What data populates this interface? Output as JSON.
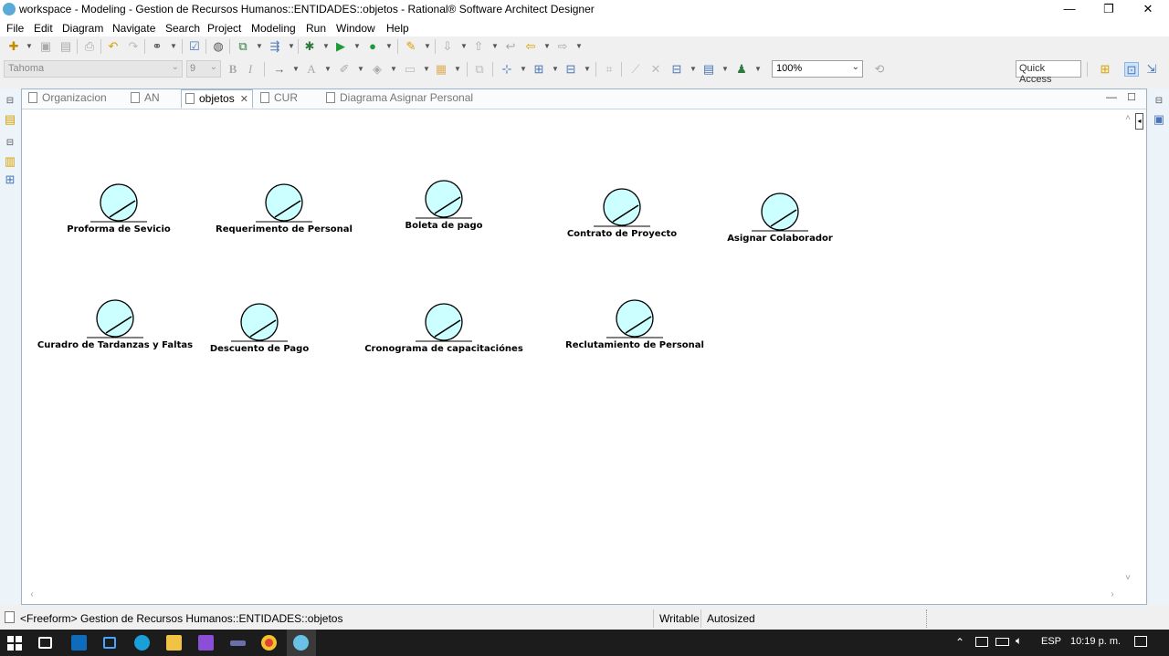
{
  "window": {
    "title": "workspace - Modeling - Gestion de Recursos Humanos::ENTIDADES::objetos - Rational® Software Architect Designer",
    "controls": {
      "minimize": "—",
      "restore": "❐",
      "close": "✕"
    }
  },
  "menu": [
    "File",
    "Edit",
    "Diagram",
    "Navigate",
    "Search",
    "Project",
    "Modeling",
    "Run",
    "Window",
    "Help"
  ],
  "toolbar2": {
    "font": "Tahoma",
    "font_size": "9",
    "bold": "B",
    "italic": "I",
    "zoom": "100%",
    "quick_access": "Quick Access"
  },
  "tabs": [
    {
      "label": "Organizacion",
      "active": false
    },
    {
      "label": "AN",
      "active": false
    },
    {
      "label": "objetos",
      "active": true,
      "close": "✕"
    },
    {
      "label": "CUR",
      "active": false
    },
    {
      "label": "Diagrama Asignar Personal",
      "active": false
    }
  ],
  "entities": [
    {
      "name": "Proforma de Sevicio"
    },
    {
      "name": "Requerimento de Personal"
    },
    {
      "name": "Boleta de pago"
    },
    {
      "name": "Contrato de Proyecto"
    },
    {
      "name": "Asignar Colaborador"
    },
    {
      "name": "Curadro de Tardanzas y Faltas"
    },
    {
      "name": "Descuento de Pago"
    },
    {
      "name": "Cronograma de capacitaciónes"
    },
    {
      "name": "Reclutamiento de Personal"
    }
  ],
  "entity_color": "#ccffff",
  "status": {
    "path": "<Freeform> Gestion de Recursos Humanos::ENTIDADES::objetos",
    "writable": "Writable",
    "autosized": "Autosized"
  },
  "taskbar": {
    "language": "ESP",
    "time": "10:19 p. m."
  }
}
